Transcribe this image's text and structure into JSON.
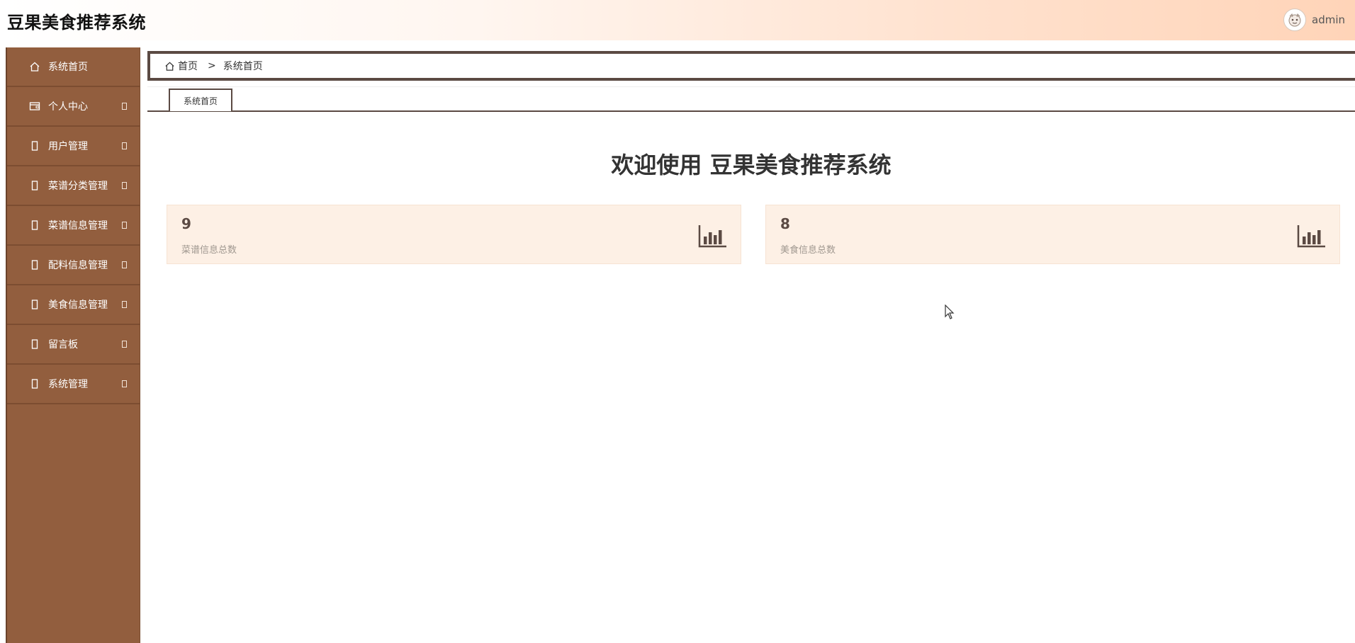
{
  "header": {
    "title": "豆果美食推荐系统",
    "username": "admin"
  },
  "sidebar": {
    "items": [
      {
        "label": "系统首页",
        "icon": "home-icon"
      },
      {
        "label": "个人中心",
        "icon": "wallet-icon"
      },
      {
        "label": "用户管理",
        "icon": "box-icon"
      },
      {
        "label": "菜谱分类管理",
        "icon": "box-icon"
      },
      {
        "label": "菜谱信息管理",
        "icon": "box-icon"
      },
      {
        "label": "配料信息管理",
        "icon": "box-icon"
      },
      {
        "label": "美食信息管理",
        "icon": "box-icon"
      },
      {
        "label": "留言板",
        "icon": "box-icon"
      },
      {
        "label": "系统管理",
        "icon": "box-icon"
      }
    ]
  },
  "breadcrumb": {
    "home": "首页",
    "separator": ">",
    "current": "系统首页"
  },
  "tabs": [
    {
      "label": "系统首页"
    }
  ],
  "main": {
    "welcome": "欢迎使用 豆果美食推荐系统",
    "cards": [
      {
        "count": "9",
        "label": "菜谱信息总数",
        "icon": "bar-chart-icon"
      },
      {
        "count": "8",
        "label": "美食信息总数",
        "icon": "bar-chart-icon"
      }
    ]
  },
  "colors": {
    "sidebar_bg": "#925e3e",
    "card_bg": "#fdf0e5",
    "border_dark": "#5b4a43"
  }
}
